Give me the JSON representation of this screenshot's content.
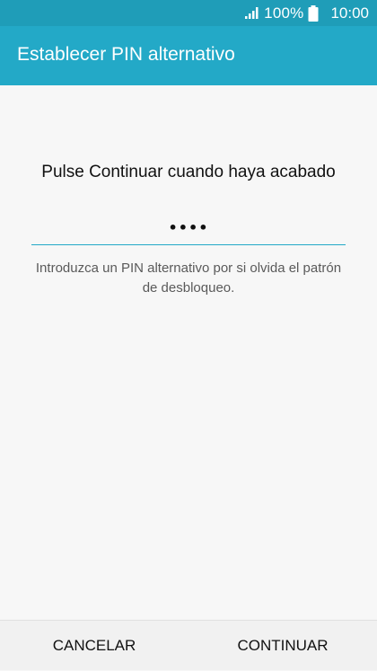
{
  "status_bar": {
    "battery_percent": "100%",
    "time": "10:00",
    "signal_icon": "signal-icon",
    "battery_icon": "battery-icon"
  },
  "app_bar": {
    "title": "Establecer PIN alternativo"
  },
  "main": {
    "instruction": "Pulse Continuar cuando haya acabado",
    "pin_value": "••••",
    "hint": "Introduzca un PIN alternativo por si olvida el patrón de desbloqueo."
  },
  "bottom": {
    "cancel_label": "CANCELAR",
    "continue_label": "CONTINUAR"
  },
  "colors": {
    "status_bar": "#1f9db8",
    "app_bar": "#23a9c7",
    "accent": "#23a9c7"
  }
}
